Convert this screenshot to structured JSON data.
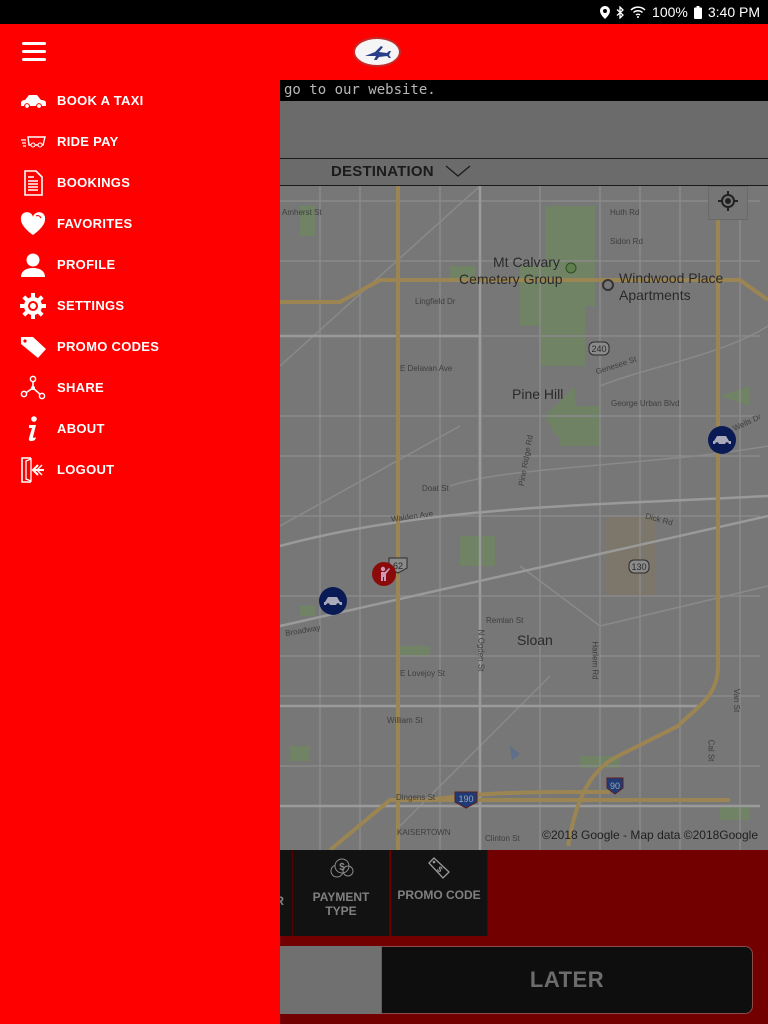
{
  "status_bar": {
    "icons": [
      "location-icon",
      "bluetooth-icon",
      "wifi-icon",
      "battery-icon"
    ],
    "battery": "100%",
    "time": "3:40 PM"
  },
  "header": {
    "logo": "airplane-logo",
    "menu_icon": "hamburger-menu-icon"
  },
  "drawer": {
    "items": [
      {
        "label": "BOOK A TAXI",
        "icon": "taxi-icon"
      },
      {
        "label": "RIDE PAY",
        "icon": "ride-pay-icon"
      },
      {
        "label": "BOOKINGS",
        "icon": "document-icon"
      },
      {
        "label": "FAVORITES",
        "icon": "heart-icon"
      },
      {
        "label": "PROFILE",
        "icon": "user-icon"
      },
      {
        "label": "SETTINGS",
        "icon": "gear-icon"
      },
      {
        "label": "PROMO CODES",
        "icon": "tag-icon"
      },
      {
        "label": "SHARE",
        "icon": "share-icon"
      },
      {
        "label": "ABOUT",
        "icon": "info-icon"
      },
      {
        "label": "LOGOUT",
        "icon": "logout-icon"
      }
    ]
  },
  "main": {
    "banner_text": "go to our website.",
    "destination_label": "DESTINATION",
    "map": {
      "places": [
        {
          "name": "Mt Calvary",
          "kind": "big"
        },
        {
          "name": "Cemetery Group",
          "kind": "big"
        },
        {
          "name": "Windwood Place",
          "kind": "big"
        },
        {
          "name": "Apartments",
          "kind": "big"
        },
        {
          "name": "Pine Hill",
          "kind": "big"
        },
        {
          "name": "Sloan",
          "kind": "big"
        }
      ],
      "streets": [
        "Amherst St",
        "Huth Rd",
        "Sidon Rd",
        "Lingfield Dr",
        "E Delavan Ave",
        "Genesee St",
        "George Urban Blvd",
        "Doat St",
        "Walden Ave",
        "Pine Ridge Rd",
        "Dick Rd",
        "Remlan St",
        "Broadway",
        "E Lovejoy St",
        "N Ogden St",
        "Harlem Rd",
        "William St",
        "Dingens St",
        "KAISERTOWN",
        "Clinton St",
        "Cal St",
        "Van St",
        "Wells Dr"
      ],
      "route_shields": [
        "240",
        "62",
        "130",
        "190",
        "90"
      ],
      "attribution": "©2018 Google - Map data ©2018Google"
    },
    "options": [
      {
        "label": "R",
        "icon": "partial-option-icon"
      },
      {
        "label": "PAYMENT TYPE",
        "icon": "coins-icon"
      },
      {
        "label": "PROMO CODE",
        "icon": "price-tag-icon"
      }
    ],
    "now_button_label": "",
    "later_button_label": "LATER"
  },
  "colors": {
    "brand_red": "#ff0000",
    "dimmed_panel": "#720000",
    "taxi_marker": "#0a1a55",
    "person_marker": "#8b0a0a"
  }
}
